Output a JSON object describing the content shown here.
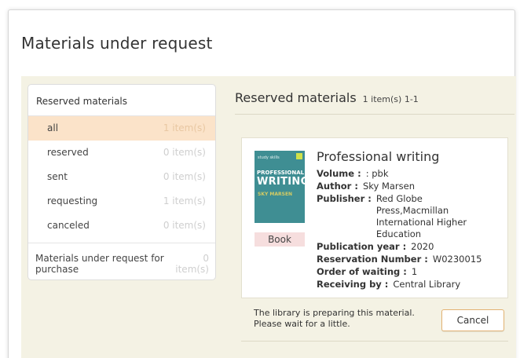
{
  "page": {
    "title": "Materials under request"
  },
  "sidebar": {
    "header": "Reserved materials",
    "items": [
      {
        "label": "all",
        "count": "1 item(s)",
        "active": true
      },
      {
        "label": "reserved",
        "count": "0 item(s)",
        "active": false
      },
      {
        "label": "sent",
        "count": "0 item(s)",
        "active": false
      },
      {
        "label": "requesting",
        "count": "1 item(s)",
        "active": false
      },
      {
        "label": "canceled",
        "count": "0 item(s)",
        "active": false
      }
    ],
    "purchase": {
      "label": "Materials under request for purchase",
      "count": "0 item(s)"
    }
  },
  "main": {
    "title": "Reserved materials",
    "count": "1 item(s) 1-1"
  },
  "book": {
    "cover": {
      "small_text": "study skills",
      "line1": "PROFESSIONAL",
      "line2": "WRITING",
      "author": "SKY MARSEN"
    },
    "type_badge": "Book",
    "title": "Professional writing",
    "volume_label": "Volume :",
    "volume": ": pbk",
    "author_label": "Author :",
    "author": "Sky Marsen",
    "publisher_label": "Publisher :",
    "publisher": "Red Globe Press,Macmillan International Higher Education",
    "year_label": "Publication year :",
    "year": "2020",
    "reservation_label": "Reservation Number :",
    "reservation": "W0230015",
    "order_label": "Order of waiting :",
    "order": "1",
    "receiving_label": "Receiving by :",
    "receiving": "Central Library"
  },
  "notice": {
    "text": "The library is preparing this material. Please wait for a little.",
    "cancel_label": "Cancel"
  },
  "colors": {
    "content_bg": "#f4f2e4",
    "active_item_bg": "#fbe3c9",
    "cover_bg": "#3f8e93",
    "badge_bg": "#f6dede",
    "button_border": "#e3b373"
  }
}
